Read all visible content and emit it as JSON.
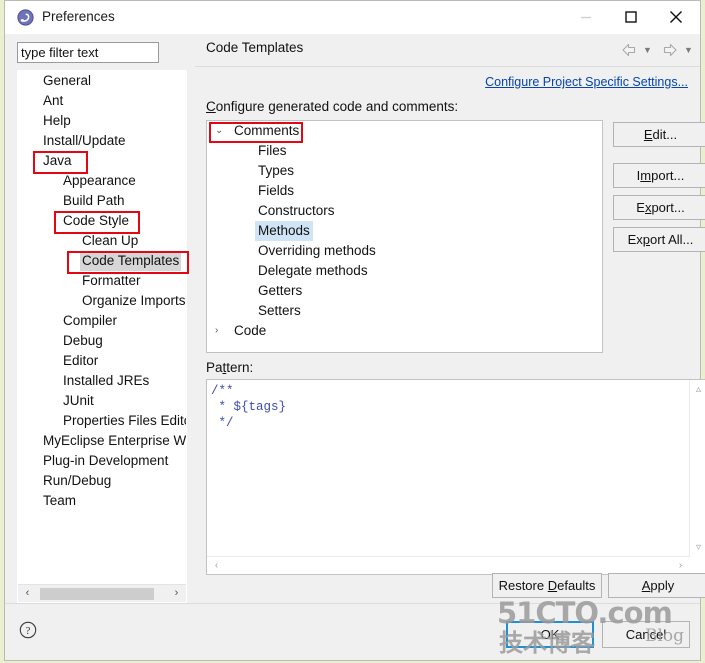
{
  "window": {
    "title": "Preferences",
    "icon": "eclipse-icon",
    "controls": {
      "minimize": "minimize-icon",
      "maximize": "maximize-icon",
      "close": "close-icon"
    }
  },
  "sidebar": {
    "filter": {
      "value": "type filter text",
      "placeholder": "type filter text"
    },
    "items": [
      {
        "label": "General",
        "depth": 0,
        "selected": false
      },
      {
        "label": "Ant",
        "depth": 0,
        "selected": false
      },
      {
        "label": "Help",
        "depth": 0,
        "selected": false
      },
      {
        "label": "Install/Update",
        "depth": 0,
        "selected": false
      },
      {
        "label": "Java",
        "depth": 0,
        "selected": false,
        "annotated": true
      },
      {
        "label": "Appearance",
        "depth": 1,
        "selected": false
      },
      {
        "label": "Build Path",
        "depth": 1,
        "selected": false
      },
      {
        "label": "Code Style",
        "depth": 1,
        "selected": false,
        "annotated": true
      },
      {
        "label": "Clean Up",
        "depth": 2,
        "selected": false
      },
      {
        "label": "Code Templates",
        "depth": 2,
        "selected": true,
        "annotated": true
      },
      {
        "label": "Formatter",
        "depth": 2,
        "selected": false
      },
      {
        "label": "Organize Imports",
        "depth": 2,
        "selected": false
      },
      {
        "label": "Compiler",
        "depth": 1,
        "selected": false
      },
      {
        "label": "Debug",
        "depth": 1,
        "selected": false
      },
      {
        "label": "Editor",
        "depth": 1,
        "selected": false
      },
      {
        "label": "Installed JREs",
        "depth": 1,
        "selected": false
      },
      {
        "label": "JUnit",
        "depth": 1,
        "selected": false
      },
      {
        "label": "Properties Files Editor",
        "depth": 1,
        "selected": false
      },
      {
        "label": "MyEclipse Enterprise Wor",
        "depth": 0,
        "selected": false
      },
      {
        "label": "Plug-in Development",
        "depth": 0,
        "selected": false
      },
      {
        "label": "Run/Debug",
        "depth": 0,
        "selected": false
      },
      {
        "label": "Team",
        "depth": 0,
        "selected": false
      }
    ],
    "scroll_left": "‹",
    "scroll_right": "›"
  },
  "page": {
    "title": "Code Templates",
    "nav_back": "back-arrow-icon",
    "nav_forward": "forward-arrow-icon",
    "nav_chevron": "▼",
    "project_link": "Configure Project Specific Settings...",
    "configure_label": "Configure generated code and comments:",
    "configure_label_mnemonic": "C",
    "configure_label_rest": "onfigure generated code and comments:"
  },
  "template_tree": [
    {
      "label": "Comments",
      "depth": 0,
      "twisty": "⌄",
      "expanded": true,
      "selected": false,
      "annotated": true
    },
    {
      "label": "Files",
      "depth": 1,
      "twisty": "",
      "selected": false
    },
    {
      "label": "Types",
      "depth": 1,
      "twisty": "",
      "selected": false
    },
    {
      "label": "Fields",
      "depth": 1,
      "twisty": "",
      "selected": false
    },
    {
      "label": "Constructors",
      "depth": 1,
      "twisty": "",
      "selected": false
    },
    {
      "label": "Methods",
      "depth": 1,
      "twisty": "",
      "selected": true
    },
    {
      "label": "Overriding methods",
      "depth": 1,
      "twisty": "",
      "selected": false
    },
    {
      "label": "Delegate methods",
      "depth": 1,
      "twisty": "",
      "selected": false
    },
    {
      "label": "Getters",
      "depth": 1,
      "twisty": "",
      "selected": false
    },
    {
      "label": "Setters",
      "depth": 1,
      "twisty": "",
      "selected": false
    },
    {
      "label": "Code",
      "depth": 0,
      "twisty": "›",
      "expanded": false,
      "selected": false
    }
  ],
  "side_buttons": {
    "edit": {
      "pre": "E",
      "post": "dit..."
    },
    "import": {
      "pre": "I",
      "mid": "m",
      "post": "port..."
    },
    "export": {
      "pre": "E",
      "mid": "x",
      "post": "port..."
    },
    "export_all": {
      "pre": "Ex",
      "mid": "p",
      "post": "ort All..."
    },
    "edit_label": "Edit...",
    "import_label": "Import...",
    "export_label": "Export...",
    "export_all_label": "Export All..."
  },
  "pattern": {
    "label_mnemonic": "Pa",
    "label_underlined": "t",
    "label_rest": "tern:",
    "label": "Pattern:",
    "value": "/**\n * ${tags}\n */",
    "text_color": "#3c4cad"
  },
  "bottom_buttons": {
    "restore_defaults_pre": "Restore ",
    "restore_defaults_mnemonic": "D",
    "restore_defaults_post": "efaults",
    "restore_defaults": "Restore Defaults",
    "apply_mnemonic": "A",
    "apply_post": "pply",
    "apply": "Apply",
    "ok": "OK",
    "cancel": "Cancel"
  },
  "footer": {
    "help_icon": "help-question-icon"
  },
  "watermark": {
    "top": "51CTO.com",
    "bottom": "技术博客",
    "blog": "Blog"
  },
  "colors": {
    "selection_blue": "#cfe4f5",
    "selection_gray": "#d6d6d6",
    "annotation_red": "#e30613",
    "link_blue": "#0645ad",
    "focus_blue": "#1e90d2",
    "window_bg": "#f0f0f0",
    "desktop": "#e9efcf"
  }
}
